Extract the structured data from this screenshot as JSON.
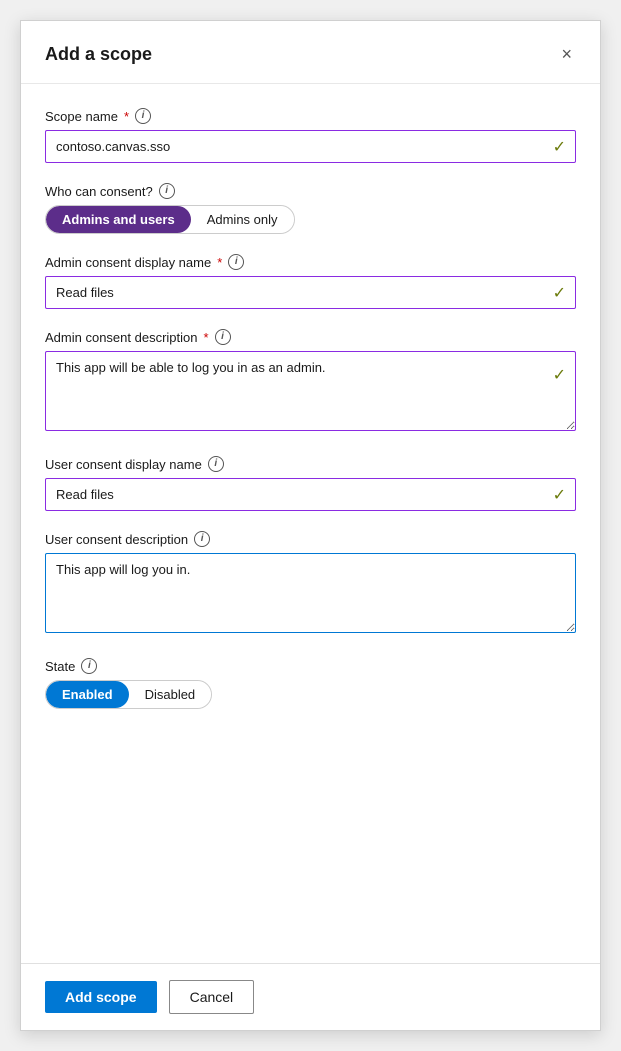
{
  "dialog": {
    "title": "Add a scope",
    "close_label": "×"
  },
  "form": {
    "scope_name": {
      "label": "Scope name",
      "required": true,
      "value": "contoso.canvas.sso",
      "info": "i"
    },
    "who_can_consent": {
      "label": "Who can consent?",
      "info": "i",
      "options": [
        {
          "label": "Admins and users",
          "active": true
        },
        {
          "label": "Admins only",
          "active": false
        }
      ]
    },
    "admin_consent_display_name": {
      "label": "Admin consent display name",
      "required": true,
      "value": "Read files",
      "info": "i"
    },
    "admin_consent_description": {
      "label": "Admin consent description",
      "required": true,
      "value": "This app will be able to log you in as an admin.",
      "info": "i"
    },
    "user_consent_display_name": {
      "label": "User consent display name",
      "info": "i",
      "value": "Read files"
    },
    "user_consent_description": {
      "label": "User consent description",
      "info": "i",
      "value": "This app will log you in."
    },
    "state": {
      "label": "State",
      "info": "i",
      "options": [
        {
          "label": "Enabled",
          "active": true
        },
        {
          "label": "Disabled",
          "active": false
        }
      ]
    }
  },
  "footer": {
    "add_scope": "Add scope",
    "cancel": "Cancel"
  }
}
